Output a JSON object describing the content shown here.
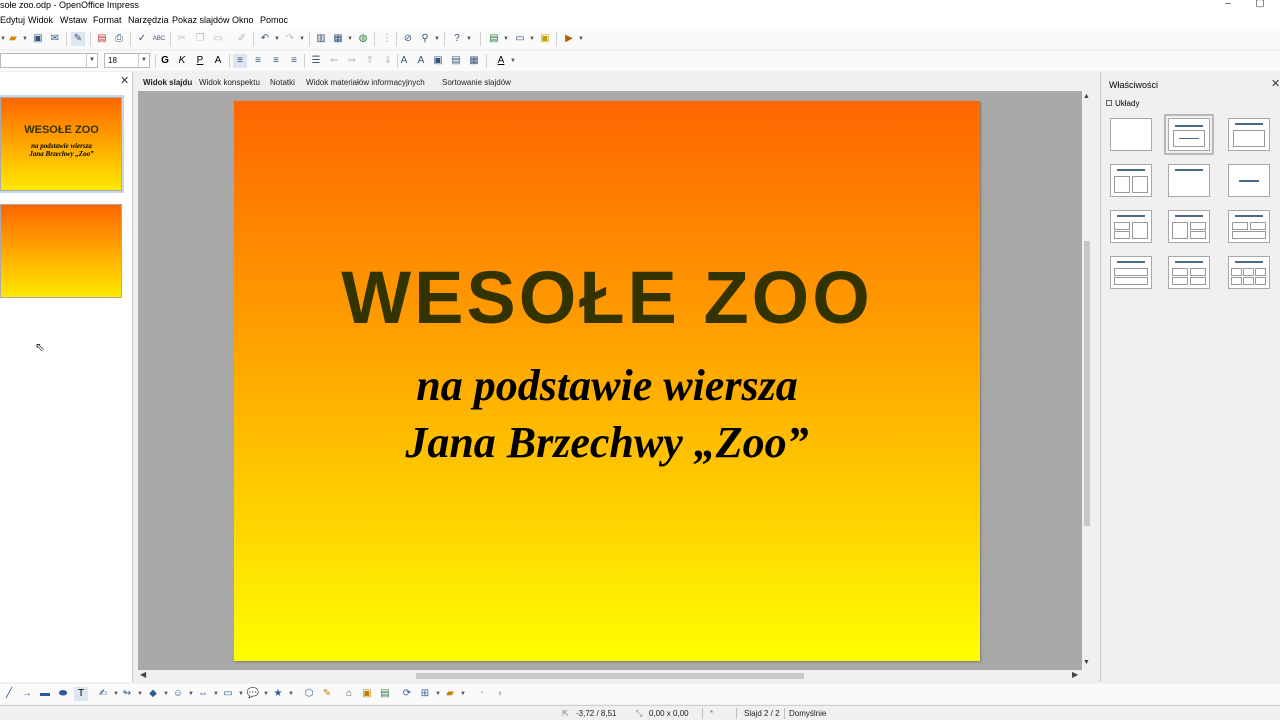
{
  "window": {
    "title": "sołe zoo.odp - OpenOffice Impress",
    "minimize": "–",
    "maximize": "▢"
  },
  "menu": [
    "Edytuj",
    "Widok",
    "Wstaw",
    "Format",
    "Narzędzia",
    "Pokaz slajdów",
    "Okno",
    "Pomoc"
  ],
  "format_toolbar": {
    "font_name": "",
    "font_size": "18"
  },
  "view_tabs": [
    "Widok slajdu",
    "Widok konspektu",
    "Notatki",
    "Widok materiałów informacyjnych",
    "Sortowanie slajdów"
  ],
  "slide": {
    "title": "WESOŁE ZOO",
    "subtitle_line1": "na podstawie wiersza",
    "subtitle_line2": "Jana Brzechwy „Zoo”"
  },
  "slides_pane": {
    "thumb1_title": "WESOŁE ZOO",
    "thumb1_sub1": "na podstawie wiersza",
    "thumb1_sub2": "Jana Brzechwy „Zoo”"
  },
  "sidebar": {
    "header": "Właściwości",
    "section": "Układy"
  },
  "status": {
    "position": "-3,72 / 8,51",
    "size": "0,00 x 0,00",
    "slide": "Slajd 2 / 2",
    "master": "Domyślnie"
  },
  "colors": {
    "slide_gradient_top": "#ff6600",
    "slide_gradient_bottom": "#ffff00",
    "title_color": "#333300"
  }
}
